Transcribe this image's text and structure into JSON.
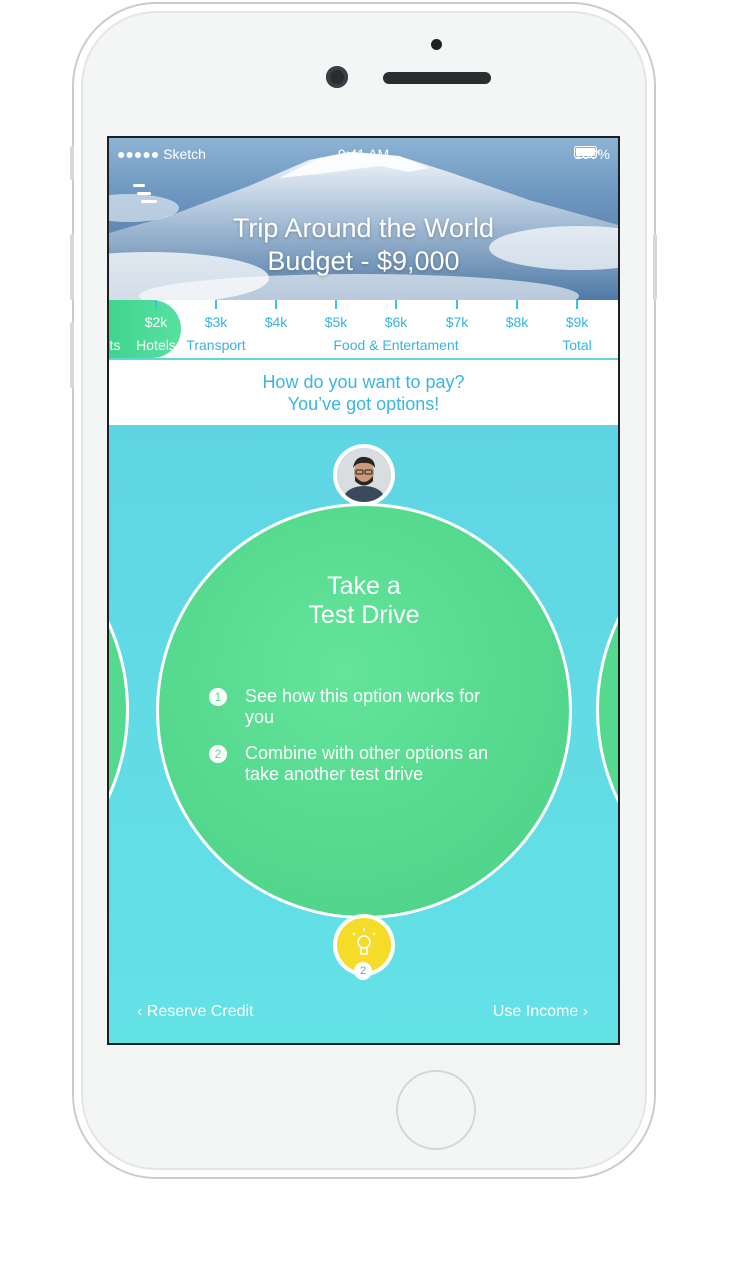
{
  "status_bar": {
    "carrier": "●●●●● Sketch",
    "time": "9:41 AM",
    "battery": "100%"
  },
  "header": {
    "title_line1": "Trip Around the World",
    "title_line2": "Budget - $9,000"
  },
  "budget_scale": {
    "ticks": [
      "$2k",
      "$3k",
      "$4k",
      "$5k",
      "$6k",
      "$7k",
      "$8k",
      "$9k"
    ],
    "categories": {
      "partial": "ts",
      "hotels": "Hotels",
      "transport": "Transport",
      "food": "Food & Entertament",
      "total": "Total"
    }
  },
  "prompt": {
    "line1": "How do you want to pay?",
    "line2": "You’ve got options!"
  },
  "option_card": {
    "title_line1": "Take a",
    "title_line2": "Test Drive",
    "steps": [
      {
        "num": "1",
        "line1": "See how this option works for",
        "line2": "you"
      },
      {
        "num": "2",
        "line1": "Combine with other options an",
        "line2": "take another test drive"
      }
    ],
    "bulb_badge": "2"
  },
  "nav": {
    "prev": "Reserve Credit",
    "next": "Use Income"
  },
  "colors": {
    "accent_blue": "#38b4e1",
    "option_green": "#55d98f",
    "background_cyan": "#5fd6e4",
    "bulb_yellow": "#f5dc29"
  }
}
